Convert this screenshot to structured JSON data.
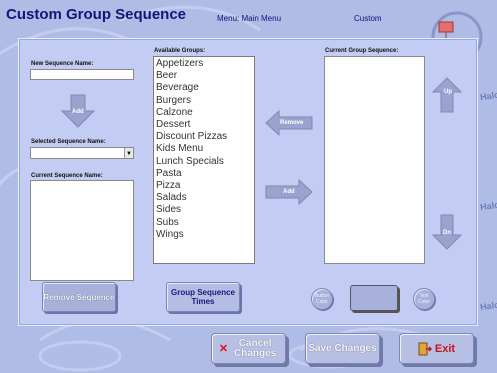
{
  "header": {
    "title": "Custom Group Sequence",
    "menu_text": "Menu:  Main Menu",
    "custom_text": "Custom"
  },
  "watermark": {
    "side_text": "Halcnol"
  },
  "left": {
    "new_sequence_label": "New Sequence Name:",
    "new_sequence_value": "",
    "add_label": "Add",
    "selected_sequence_label": "Selected Sequence Name:",
    "selected_sequence_value": "",
    "current_sequence_label": "Current Sequence Name:",
    "current_sequence_value": ""
  },
  "available": {
    "label": "Available Groups:",
    "items": [
      "Appetizers",
      "Beer",
      "Beverage",
      "Burgers",
      "Calzone",
      "Dessert",
      "Discount Pizzas",
      "Kids Menu",
      "Lunch Specials",
      "Pasta",
      "Pizza",
      "Salads",
      "Sides",
      "Subs",
      "Wings"
    ]
  },
  "middle": {
    "remove_label": "Remove",
    "add_label": "Add"
  },
  "current_group": {
    "label": "Current Group Sequence:",
    "up_label": "Up",
    "down_label": "Dn"
  },
  "buttons": {
    "remove_sequence": "Remove Sequence",
    "group_sequence_times": "Group Sequence Times",
    "button_color": "Button Color",
    "text_color": "Text Color",
    "cancel_changes": "Cancel Changes",
    "cancel_icon": "✕",
    "save_changes": "Save Changes",
    "exit": "Exit"
  },
  "colors": {
    "accent": "#1a1a7e",
    "background": "#aebce6",
    "exit_red": "#c0161a"
  }
}
